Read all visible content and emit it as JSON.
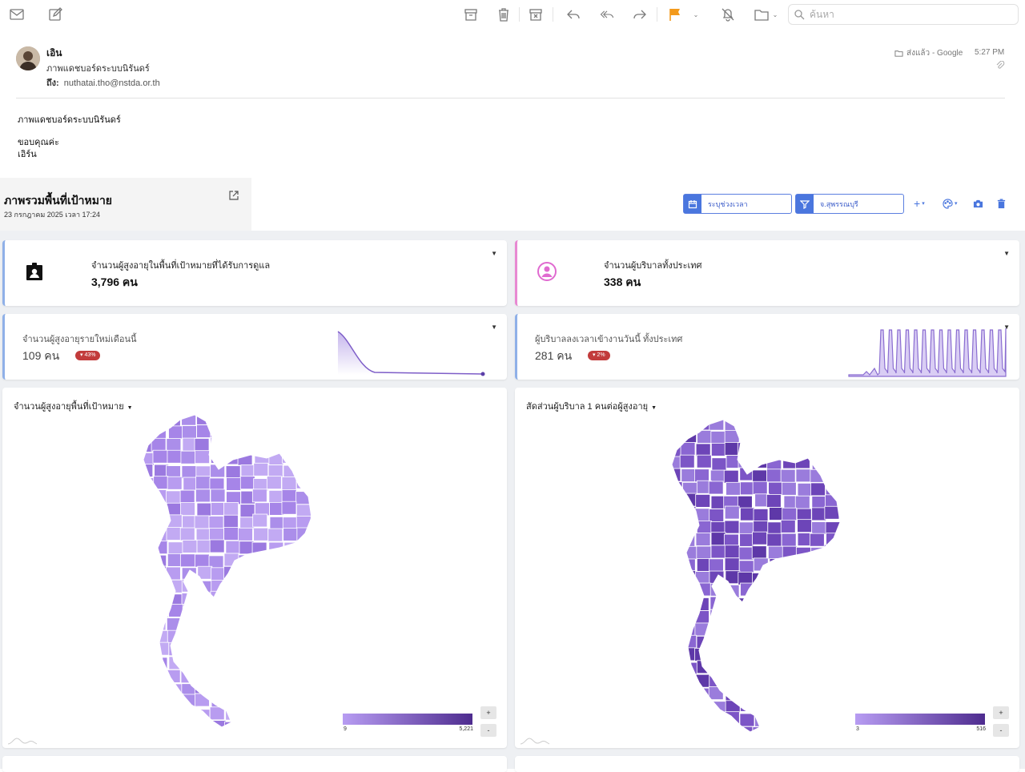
{
  "toolbar": {
    "search_placeholder": "ค้นหา",
    "flag_color": "#f39a1c"
  },
  "message": {
    "sender": "เอิน",
    "subject": "ภาพแดชบอร์ดระบบนิรันดร์",
    "to_label": "ถึง:",
    "to_address": "nuthatai.tho@nstda.or.th",
    "mailbox": "ส่งแล้ว - Google",
    "time": "5:27 PM",
    "body": [
      "ภาพแดชบอร์ดระบบนิรันดร์",
      "ขอบคุณค่ะ",
      "เอิร์น"
    ]
  },
  "dashboard": {
    "title": "ภาพรวมพื้นที่เป้าหมาย",
    "date": "23 กรกฎาคม 2025 เวลา 17:24",
    "date_filter": "ระบุช่วงเวลา",
    "province_filter": "จ.สุพรรณบุรี",
    "accent_color": "#4a76de"
  },
  "kpi_cards": [
    {
      "label": "จำนวนผู้สูงอายุในพื้นที่เป้าหมายที่ได้รับการดูแล",
      "value": "3,796 คน",
      "icon": "contact-badge-icon"
    },
    {
      "label": "จำนวนผู้บริบาลทั้งประเทศ",
      "value": "338 คน",
      "icon": "user-circle-icon"
    }
  ],
  "spark_cards": [
    {
      "label": "จำนวนผู้สูงอายุรายใหม่เดือนนี้",
      "value": "109 คน",
      "badge": "▾ 43%"
    },
    {
      "label": "ผู้บริบาลลงเวลาเข้างานวันนี้ ทั้งประเทศ",
      "value": "281 คน",
      "badge": "▾ 2%"
    }
  ],
  "maps": [
    {
      "title": "จำนวนผู้สูงอายุพื้นที่เป้าหมาย",
      "legend_min": "9",
      "legend_max": "5,221"
    },
    {
      "title": "สัดส่วนผู้บริบาล 1 คนต่อผู้สูงอายุ",
      "legend_min": "3",
      "legend_max": "516"
    }
  ],
  "zoom": {
    "in": "+",
    "out": "-"
  }
}
